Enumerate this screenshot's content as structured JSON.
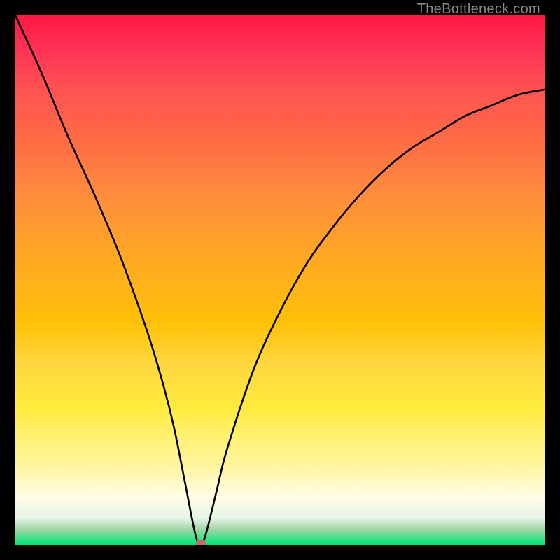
{
  "watermark": "TheBottleneck.com",
  "chart_data": {
    "type": "line",
    "title": "",
    "xlabel": "",
    "ylabel": "",
    "xlim": [
      0,
      100
    ],
    "ylim": [
      0,
      100
    ],
    "grid": false,
    "legend": false,
    "series": [
      {
        "name": "curve",
        "x": [
          0,
          5,
          10,
          15,
          20,
          25,
          28,
          30,
          32,
          34,
          35,
          36,
          38,
          40,
          45,
          50,
          55,
          60,
          65,
          70,
          75,
          80,
          85,
          90,
          95,
          100
        ],
        "y": [
          100,
          89,
          77,
          66,
          54,
          40,
          30,
          22,
          12,
          2,
          0,
          2,
          10,
          18,
          33,
          44,
          53,
          60,
          66,
          71,
          75,
          78,
          81,
          83,
          85,
          86
        ]
      }
    ],
    "marker": {
      "x": 35,
      "y": 0,
      "color": "#c96a6a"
    },
    "background_gradient": {
      "top": "#ff1744",
      "mid": "#ffeb3b",
      "bottom": "#00e676"
    }
  }
}
